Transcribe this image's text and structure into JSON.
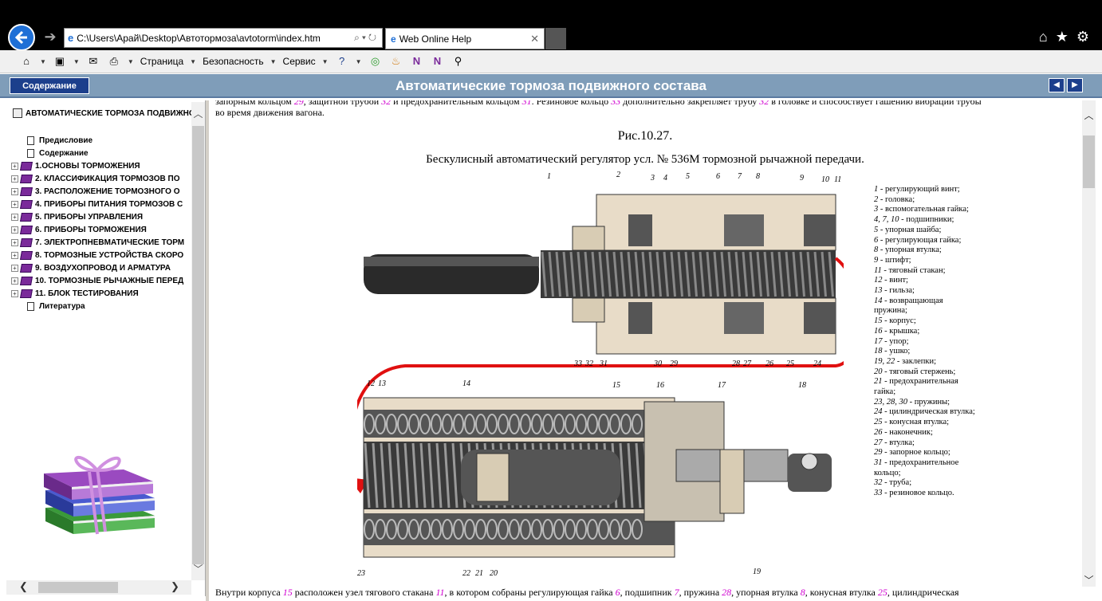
{
  "browser": {
    "address": "C:\\Users\\Арай\\Desktop\\Автотормоза\\avtotorm\\index.htm",
    "tab_title": "Web Online Help",
    "menus": [
      "Страница",
      "Безопасность",
      "Сервис"
    ]
  },
  "help": {
    "contents_button": "Содержание",
    "title": "Автоматические тормоза подвижного состава"
  },
  "toc": {
    "root": "АВТОМАТИЧЕСКИЕ ТОРМОЗА ПОДВИЖНО",
    "items": [
      {
        "label": "Предисловие",
        "type": "page"
      },
      {
        "label": "Содержание",
        "type": "page"
      },
      {
        "label": "1.ОСНОВЫ ТОРМОЖЕНИЯ",
        "type": "book"
      },
      {
        "label": "2. КЛАССИФИКАЦИЯ ТОРМОЗОВ ПО",
        "type": "book"
      },
      {
        "label": "3. РАСПОЛОЖЕНИЕ ТОРМОЗНОГО О",
        "type": "book"
      },
      {
        "label": "4. ПРИБОРЫ ПИТАНИЯ ТОРМОЗОВ С",
        "type": "book"
      },
      {
        "label": "5. ПРИБОРЫ УПРАВЛЕНИЯ",
        "type": "book"
      },
      {
        "label": "6. ПРИБОРЫ ТОРМОЖЕНИЯ",
        "type": "book"
      },
      {
        "label": "7. ЭЛЕКТРОПНЕВМАТИЧЕСКИЕ ТОРМ",
        "type": "book"
      },
      {
        "label": "8. ТОРМОЗНЫЕ УСТРОЙСТВА СКОРО",
        "type": "book"
      },
      {
        "label": "9. ВОЗДУХОПРОВОД И АРМАТУРА",
        "type": "book"
      },
      {
        "label": "10. ТОРМОЗНЫЕ РЫЧАЖНЫЕ ПЕРЕД",
        "type": "book"
      },
      {
        "label": "11. БЛОК ТЕСТИРОВАНИЯ",
        "type": "book"
      },
      {
        "label": "Литература",
        "type": "page"
      }
    ]
  },
  "content": {
    "intro_line1_a": "запорным кольцом ",
    "intro_line1_n1": "29",
    "intro_line1_b": ", защитной трубой ",
    "intro_line1_n2": "32",
    "intro_line1_c": " и предохранительным кольцом ",
    "intro_line1_n3": "31",
    "intro_line1_d": ". Резиновое кольцо ",
    "intro_line1_n4": "33",
    "intro_line1_e": " дополнительно закрепляет трубу ",
    "intro_line1_n5": "32",
    "intro_line1_f": " в головке и способствует гашению вибрации трубы",
    "intro_line2": "во время движения вагона.",
    "fig_caption": "Рис.10.27.",
    "fig_title": "Бескулисный автоматический регулятор усл. № 536М тормозной рычажной передачи.",
    "bottom_a": "Внутри корпуса ",
    "bottom_n1": "15",
    "bottom_b": " расположен узел тягового стакана ",
    "bottom_n2": "11",
    "bottom_c": ", в котором собраны регулирующая гайка ",
    "bottom_n3": "6",
    "bottom_d": ", подшипник ",
    "bottom_n4": "7",
    "bottom_e": ", пружина ",
    "bottom_n5": "28",
    "bottom_f": ", упорная втулка ",
    "bottom_n6": "8",
    "bottom_g": ", конусная втулка ",
    "bottom_n7": "25",
    "bottom_h": ", цилиндрическая"
  },
  "figure_labels_top": [
    "1",
    "2",
    "3",
    "4",
    "5",
    "6",
    "7",
    "8",
    "9",
    "10",
    "11"
  ],
  "figure_labels_mid": [
    "33",
    "32",
    "31",
    "30",
    "29",
    "28",
    "27",
    "26",
    "25",
    "24"
  ],
  "figure_labels_lower": [
    "12",
    "13",
    "14",
    "15",
    "16",
    "17",
    "18"
  ],
  "figure_labels_bottom": [
    "23",
    "22",
    "21",
    "20",
    "19"
  ],
  "legend": [
    {
      "n": "1",
      "t": " - регулирующий винт;"
    },
    {
      "n": "2",
      "t": " - головка;"
    },
    {
      "n": "3",
      "t": " - вспомогательная гайка;"
    },
    {
      "n": "4, 7, 10",
      "t": " - подшипники;"
    },
    {
      "n": "5",
      "t": " - упорная шайба;"
    },
    {
      "n": "6",
      "t": " - регулирующая гайка;"
    },
    {
      "n": "8",
      "t": " -  упорная втулка;"
    },
    {
      "n": "9",
      "t": " - штифт;"
    },
    {
      "n": "11",
      "t": " - тяговый стакан;"
    },
    {
      "n": "12",
      "t": " - винт;"
    },
    {
      "n": "13",
      "t": " - гильза;"
    },
    {
      "n": "14",
      "t": " - возвращающая пружина;"
    },
    {
      "n": "15",
      "t": " - корпус;"
    },
    {
      "n": "16",
      "t": " - крышка;"
    },
    {
      "n": "17",
      "t": " - упор;"
    },
    {
      "n": "18",
      "t": " - ушко;"
    },
    {
      "n": "19, 22",
      "t": " - заклепки;"
    },
    {
      "n": "20",
      "t": " - тяговый стержень;"
    },
    {
      "n": "21",
      "t": " - предохранительная гайка;"
    },
    {
      "n": "23, 28, 30",
      "t": " - пружины;"
    },
    {
      "n": "24",
      "t": " - цилиндрическая втулка;"
    },
    {
      "n": "25",
      "t": " - конусная втулка;"
    },
    {
      "n": "26",
      "t": " - наконечник;"
    },
    {
      "n": "27",
      "t": " - втулка;"
    },
    {
      "n": "29",
      "t": " - запорное кольцо;"
    },
    {
      "n": "31",
      "t": " - предохранительное кольцо;"
    },
    {
      "n": "32",
      "t": " - труба;"
    },
    {
      "n": "33",
      "t": " - резиновое кольцо."
    }
  ]
}
